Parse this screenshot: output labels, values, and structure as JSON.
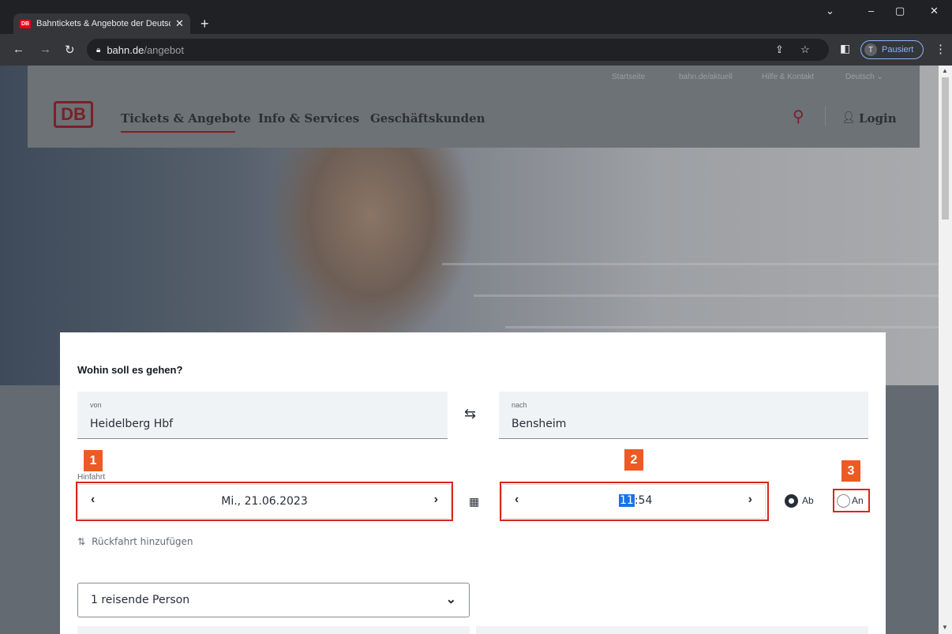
{
  "browser": {
    "tab_title": "Bahntickets & Angebote der Deutschen Bahn",
    "favicon_text": "DB",
    "tab_close": "✕",
    "new_tab": "+",
    "url_host": "bahn.de",
    "url_path": "/angebot",
    "profile_initial": "T",
    "profile_label": "Pausiert",
    "win_down": "⌄",
    "win_min": "–",
    "win_max": "▢",
    "win_close": "✕"
  },
  "header": {
    "meta_links": [
      "Startseite",
      "bahn.de/aktuell",
      "Hilfe & Kontakt",
      "Deutsch ⌄"
    ],
    "logo_text": "DB",
    "nav": [
      "Tickets & Angebote",
      "Info & Services",
      "Geschäftskunden"
    ],
    "login_label": "Login"
  },
  "booking": {
    "title": "Wohin soll es gehen?",
    "from_label": "von",
    "from_value": "Heidelberg Hbf",
    "to_label": "nach",
    "to_value": "Bensheim",
    "section_label": "Hinfahrt",
    "date_value": "Mi., 21.06.2023",
    "time_hour": "11",
    "time_minute": ":54",
    "radio_ab": "Ab",
    "radio_an": "An",
    "return_link": "Rückfahrt hinzufügen",
    "travellers": "1 reisende Person"
  },
  "annotations": {
    "marker_1": "1",
    "marker_2": "2",
    "marker_3": "3",
    "highlight_color": "#d7261e",
    "marker_color": "#ee5a24"
  },
  "colors": {
    "db_red": "#ec0016",
    "overlay_gray": "#636a72"
  }
}
